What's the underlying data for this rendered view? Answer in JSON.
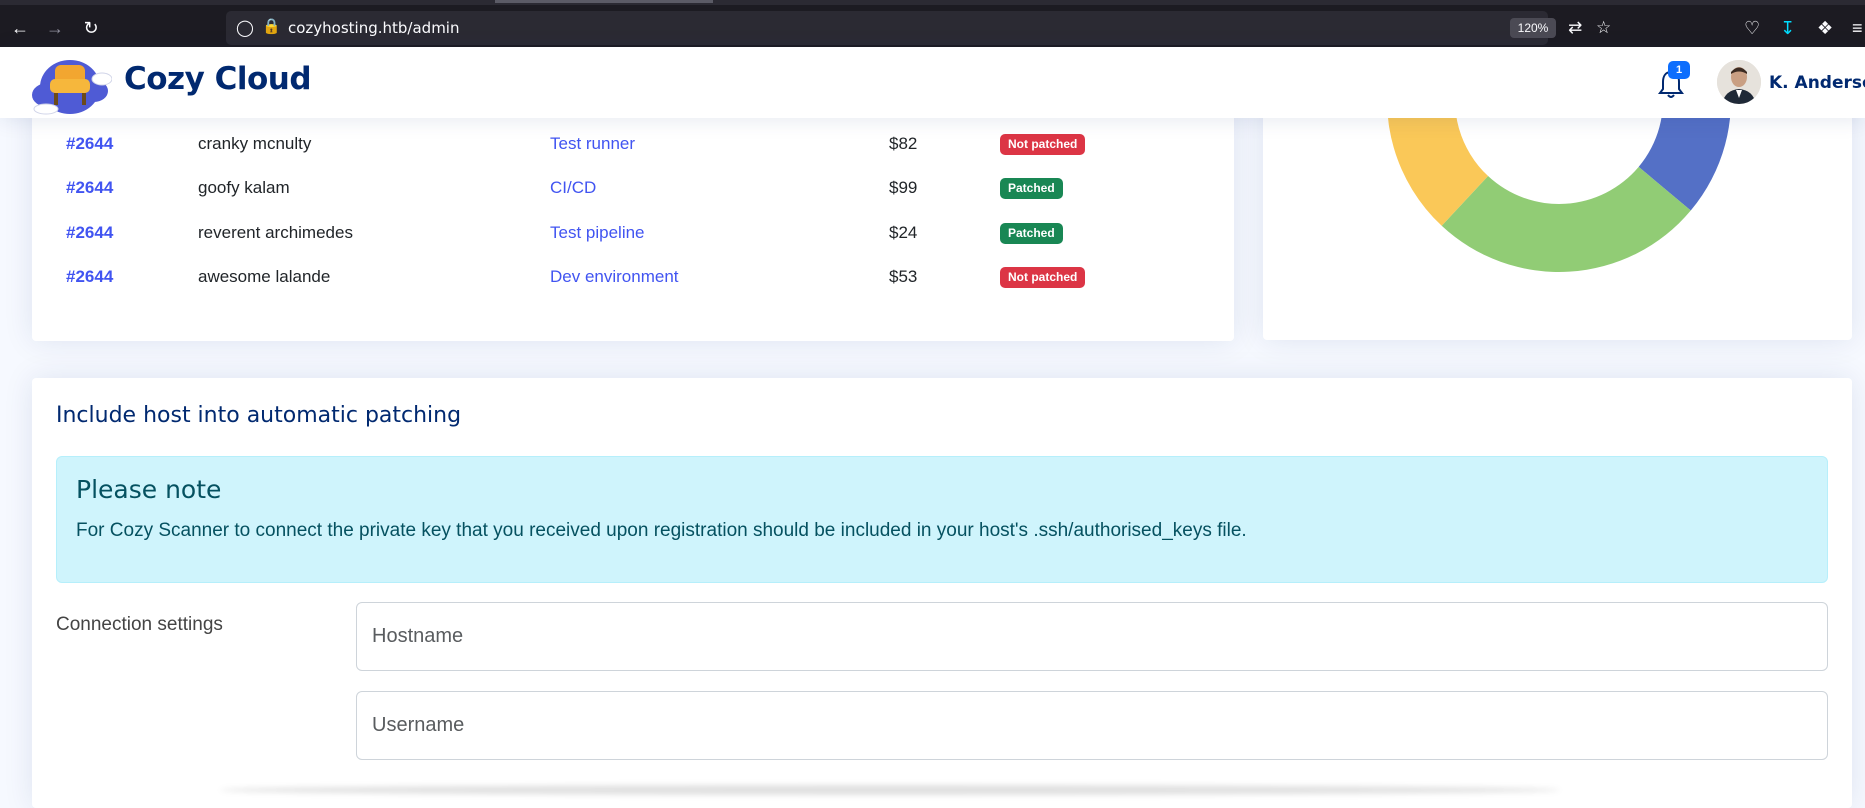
{
  "browser": {
    "url": "cozyhosting.htb/admin",
    "zoom": "120%"
  },
  "header": {
    "brand": "Cozy Cloud",
    "notification_count": "1",
    "user_name": "K. Anderson"
  },
  "recent_sales": {
    "rows": [
      {
        "id": "#2644",
        "customer": "cranky mcnulty",
        "product": "Test runner",
        "price": "$82",
        "status": "Not patched",
        "status_type": "bad"
      },
      {
        "id": "#2644",
        "customer": "goofy kalam",
        "product": "CI/CD",
        "price": "$99",
        "status": "Patched",
        "status_type": "good"
      },
      {
        "id": "#2644",
        "customer": "reverent archimedes",
        "product": "Test pipeline",
        "price": "$24",
        "status": "Patched",
        "status_type": "good"
      },
      {
        "id": "#2644",
        "customer": "awesome lalande",
        "product": "Dev environment",
        "price": "$53",
        "status": "Not patched",
        "status_type": "bad"
      }
    ]
  },
  "donut_colors": {
    "yellow": "#fac858",
    "green": "#91cc75",
    "blue": "#5470c6"
  },
  "automatic_patching": {
    "title": "Include host into automatic patching",
    "alert_title": "Please note",
    "alert_text": "For Cozy Scanner to connect the private key that you received upon registration should be included in your host's .ssh/authorised_keys file.",
    "connection_label": "Connection settings",
    "hostname_placeholder": "Hostname",
    "username_placeholder": "Username"
  }
}
